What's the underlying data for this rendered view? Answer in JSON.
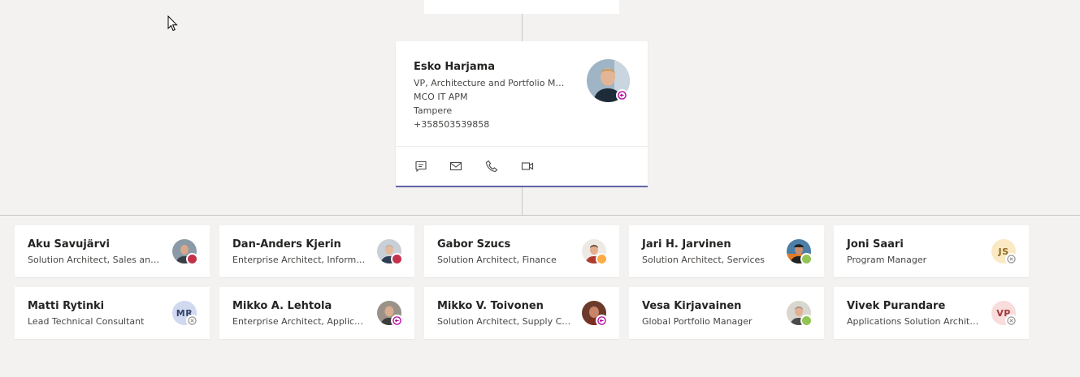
{
  "focus": {
    "name": "Esko Harjama",
    "title": "VP, Architecture and Portfolio Ma...",
    "department": "MCO IT APM",
    "location": "Tampere",
    "phone": "+358503539858",
    "status": "out-of-office",
    "actions": [
      {
        "icon": "chat-icon"
      },
      {
        "icon": "mail-icon"
      },
      {
        "icon": "phone-icon"
      },
      {
        "icon": "video-icon"
      }
    ]
  },
  "reports": [
    {
      "name": "Aku Savujärvi",
      "title": "Solution Architect, Sales and ...",
      "status": "busy"
    },
    {
      "name": "Dan-Anders Kjerin",
      "title": "Enterprise Architect, Informati...",
      "status": "busy"
    },
    {
      "name": "Gabor Szucs",
      "title": "Solution Architect, Finance",
      "status": "away"
    },
    {
      "name": "Jari H. Jarvinen",
      "title": "Solution Architect, Services",
      "status": "available"
    },
    {
      "name": "Joni Saari",
      "title": "Program Manager",
      "status": "offline",
      "initials": "JS"
    },
    {
      "name": "Matti Rytinki",
      "title": "Lead Technical Consultant",
      "status": "offline",
      "initials": "MR"
    },
    {
      "name": "Mikko A. Lehtola",
      "title": "Enterprise Architect, Applicati...",
      "status": "out-of-office"
    },
    {
      "name": "Mikko V. Toivonen",
      "title": "Solution Architect, Supply Ch...",
      "status": "out-of-office"
    },
    {
      "name": "Vesa Kirjavainen",
      "title": "Global Portfolio Manager",
      "status": "available"
    },
    {
      "name": "Vivek Purandare",
      "title": "Applications Solution Architec...",
      "status": "offline",
      "initials": "VP"
    }
  ],
  "colors": {
    "accent": "#6264a7",
    "busy": "#c4314b",
    "away": "#ffaa44",
    "available": "#92c353",
    "out-of-office": "#b4009e",
    "offline": "#8a8886"
  }
}
